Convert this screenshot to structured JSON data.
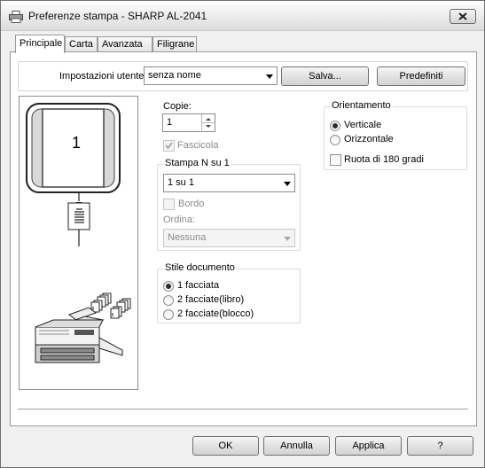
{
  "window": {
    "title": "Preferenze stampa - SHARP AL-2041",
    "icon": "printer-icon"
  },
  "tabs": [
    {
      "label": "Principale",
      "active": true
    },
    {
      "label": "Carta",
      "active": false
    },
    {
      "label": "Avanzata",
      "active": false
    },
    {
      "label": "Filigrane",
      "active": false
    }
  ],
  "user_settings": {
    "label": "Impostazioni utente:",
    "value": "senza nome",
    "save_label": "Salva...",
    "defaults_label": "Predefiniti"
  },
  "preview": {
    "page_number": "1"
  },
  "copies": {
    "label": "Copie:",
    "value": "1",
    "collate_label": "Fascicola",
    "collate_checked": true,
    "collate_enabled": false
  },
  "n_up": {
    "legend": "Stampa N su 1",
    "value": "1 su 1",
    "border_label": "Bordo",
    "border_checked": false,
    "order_label": "Ordina:",
    "order_value": "Nessuna"
  },
  "document_style": {
    "legend": "Stile documento",
    "options": [
      {
        "label": "1 facciata",
        "selected": true
      },
      {
        "label": "2 facciate(libro)",
        "selected": false
      },
      {
        "label": "2 facciate(blocco)",
        "selected": false
      }
    ]
  },
  "orientation": {
    "legend": "Orientamento",
    "options": [
      {
        "label": "Verticale",
        "selected": true
      },
      {
        "label": "Orizzontale",
        "selected": false
      }
    ],
    "rotate_label": "Ruota di 180 gradi",
    "rotate_checked": false
  },
  "buttons": {
    "ok": "OK",
    "cancel": "Annulla",
    "apply": "Applica",
    "help": "?"
  }
}
